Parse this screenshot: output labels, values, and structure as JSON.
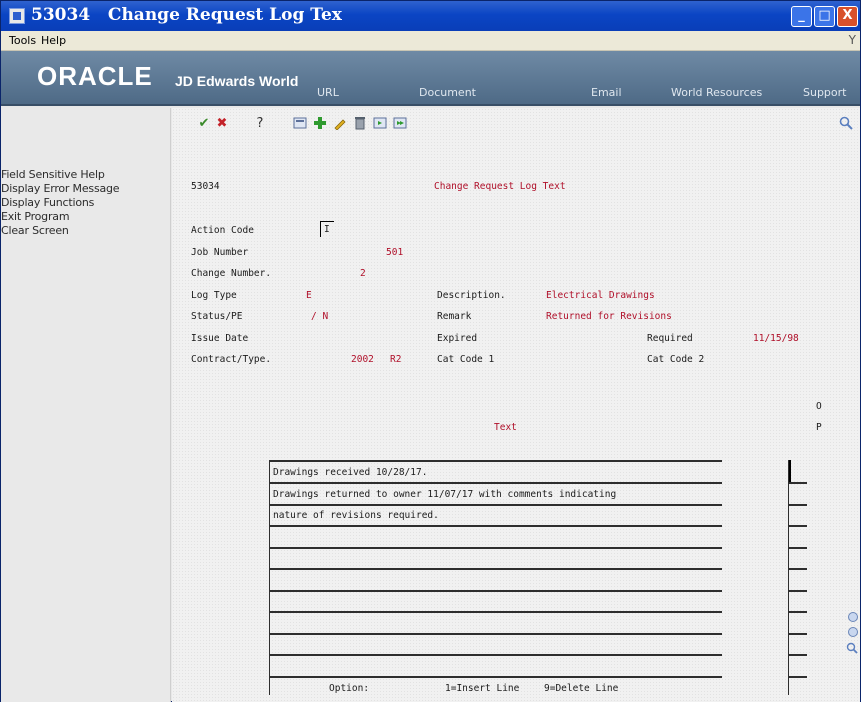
{
  "window": {
    "title_number": "53034",
    "title_text": "Change Request Log Tex",
    "min_label": "_",
    "max_label": "□",
    "close_label": "X"
  },
  "menubar": {
    "tools": "Tools",
    "help": "Help",
    "right_glyph": "Y"
  },
  "banner": {
    "oracle": "ORACLE",
    "product": "JD Edwards World",
    "links": [
      "URL",
      "Document",
      "Email",
      "World Resources",
      "Support"
    ]
  },
  "sidebar": {
    "items": [
      "Field Sensitive Help",
      "Display Error Message",
      "Display Functions",
      "Exit Program",
      "Clear Screen"
    ]
  },
  "toolbar": {
    "ok_icon": "check-icon",
    "cancel_icon": "close-icon",
    "help_glyph": "?"
  },
  "form": {
    "program_id": "53034",
    "screen_title": "Change Request Log Text",
    "action_code_label": "Action Code",
    "action_code_value": "I",
    "job_number_label": "Job Number",
    "job_number_value": "501",
    "change_number_label": "Change Number.",
    "change_number_value": "2",
    "log_type_label": "Log Type",
    "log_type_value": "E",
    "description_label": "Description.",
    "description_value": "Electrical Drawings",
    "status_label": "Status/PE",
    "status_value": "/ N",
    "remark_label": "Remark",
    "remark_value": "Returned for Revisions",
    "issue_date_label": "Issue Date",
    "expired_label": "Expired",
    "required_label": "Required",
    "required_value": "11/15/98",
    "contract_label": "Contract/Type.",
    "contract_value": "2002",
    "contract_type_value": "R2",
    "cat1_label": "Cat Code 1",
    "cat2_label": "Cat Code 2",
    "text_header": "Text",
    "op_header_1": "O",
    "op_header_2": "P",
    "text_lines": [
      "Drawings received 10/28/17.",
      "Drawings returned to owner 11/07/17 with comments indicating",
      "nature of revisions required.",
      "",
      "",
      "",
      "",
      "",
      "",
      ""
    ],
    "option_label": "Option:",
    "option_insert": "1=Insert Line",
    "option_delete": "9=Delete Line"
  }
}
